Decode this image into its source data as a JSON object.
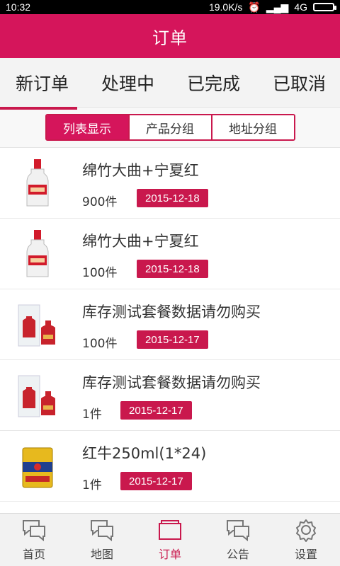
{
  "status_bar": {
    "time": "10:32",
    "net_speed": "19.0K/s",
    "network": "4G"
  },
  "title": "订单",
  "tabs": [
    {
      "label": "新订单"
    },
    {
      "label": "处理中"
    },
    {
      "label": "已完成"
    },
    {
      "label": "已取消"
    }
  ],
  "segments": [
    {
      "label": "列表显示"
    },
    {
      "label": "产品分组"
    },
    {
      "label": "地址分组"
    }
  ],
  "orders": [
    {
      "name": "绵竹大曲+宁夏红",
      "qty": "900件",
      "date": "2015-12-18",
      "product_icon": "liquor-bottle-icon"
    },
    {
      "name": "绵竹大曲+宁夏红",
      "qty": "100件",
      "date": "2015-12-18",
      "product_icon": "liquor-bottle-icon"
    },
    {
      "name": "库存测试套餐数据请勿购买",
      "qty": "100件",
      "date": "2015-12-17",
      "product_icon": "gift-set-icon"
    },
    {
      "name": "库存测试套餐数据请勿购买",
      "qty": "1件",
      "date": "2015-12-17",
      "product_icon": "gift-set-icon"
    },
    {
      "name": "红牛250ml(1*24)",
      "qty": "1件",
      "date": "2015-12-17",
      "product_icon": "energy-drink-can-icon"
    }
  ],
  "bottom_nav": [
    {
      "label": "首页",
      "icon": "chat-bubbles-icon"
    },
    {
      "label": "地图",
      "icon": "chat-bubbles-icon"
    },
    {
      "label": "订单",
      "icon": "orders-icon"
    },
    {
      "label": "公告",
      "icon": "chat-bubbles-icon"
    },
    {
      "label": "设置",
      "icon": "gear-icon"
    }
  ],
  "colors": {
    "accent": "#c9184d",
    "title_bar": "#d5155b"
  }
}
